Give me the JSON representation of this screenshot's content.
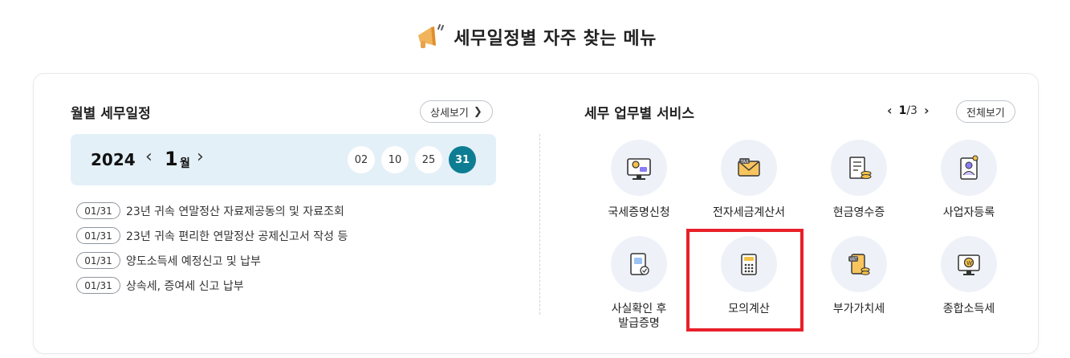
{
  "page": {
    "heading": "세무일정별 자주 찾는 메뉴"
  },
  "schedule": {
    "title": "월별 세무일정",
    "more_label": "상세보기",
    "year": "2024",
    "month": "1",
    "month_unit": "월",
    "days": [
      "02",
      "10",
      "25",
      "31"
    ],
    "active_day": "31",
    "items": [
      {
        "date": "01/31",
        "text": "23년 귀속 연말정산 자료제공동의 및 자료조회"
      },
      {
        "date": "01/31",
        "text": "23년 귀속 편리한 연말정산 공제신고서 작성 등"
      },
      {
        "date": "01/31",
        "text": "양도소득세 예정신고 및 납부"
      },
      {
        "date": "01/31",
        "text": "상속세, 증여세 신고 납부"
      }
    ]
  },
  "services": {
    "title": "세무 업무별 서비스",
    "page_current": "1",
    "page_total": "/3",
    "view_all_label": "전체보기",
    "items": [
      {
        "label": "국세증명신청",
        "icon": "certificate-monitor-icon"
      },
      {
        "label": "전자세금계산서",
        "icon": "tax-invoice-envelope-icon"
      },
      {
        "label": "현금영수증",
        "icon": "cash-receipt-icon"
      },
      {
        "label": "사업자등록",
        "icon": "business-registration-icon"
      },
      {
        "label": "사실확인 후",
        "label2": "발급증명",
        "icon": "fact-confirmation-document-icon"
      },
      {
        "label": "모의계산",
        "icon": "calculator-icon"
      },
      {
        "label": "부가가치세",
        "icon": "vat-document-icon"
      },
      {
        "label": "종합소득세",
        "icon": "income-tax-monitor-icon"
      }
    ]
  },
  "colors": {
    "accent": "#0d7d93",
    "date_bar_bg": "#e4f0f8",
    "highlight": "#e8202a",
    "icon_bg": "#eef2f8"
  }
}
